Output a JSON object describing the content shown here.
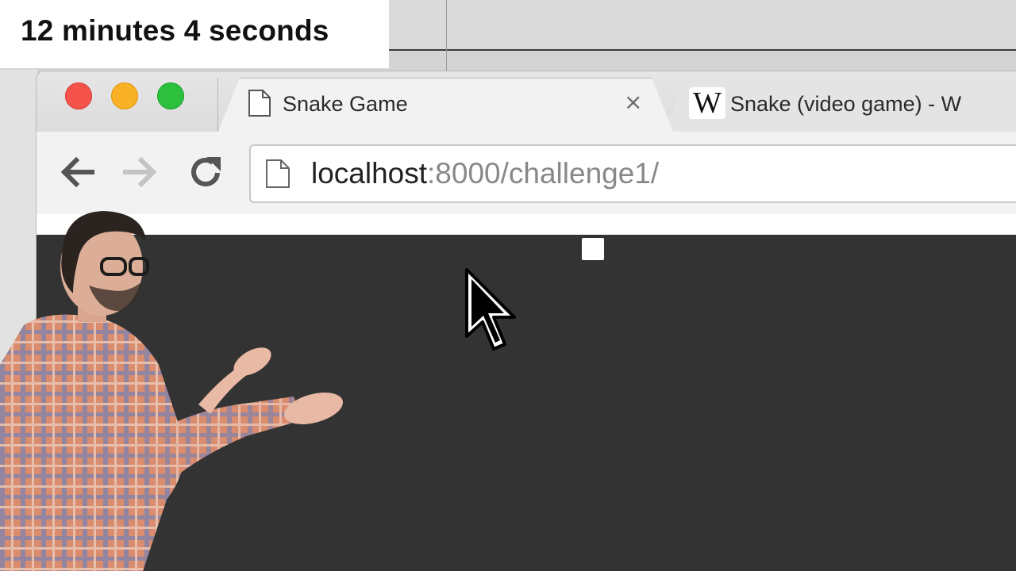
{
  "caption": {
    "elapsed_label": "12 minutes 4 seconds"
  },
  "browser": {
    "tabs": [
      {
        "title": "Snake Game",
        "icon": "page-icon",
        "active": true,
        "close_label": "×"
      },
      {
        "title": "Snake (video game) - W",
        "icon": "wikipedia-w-icon",
        "active": false
      }
    ],
    "favicon_wikipedia": "W",
    "toolbar": {
      "back_icon": "back-arrow-icon",
      "forward_icon": "forward-arrow-icon",
      "reload_icon": "reload-icon"
    },
    "address_bar": {
      "host": "localhost",
      "path": ":8000/challenge1/"
    }
  },
  "game": {
    "background_color": "#333333",
    "food_color": "#ffffff"
  },
  "colors": {
    "traffic_close": "#f4534b",
    "traffic_minimize": "#f9b226",
    "traffic_zoom": "#2cc03d"
  }
}
